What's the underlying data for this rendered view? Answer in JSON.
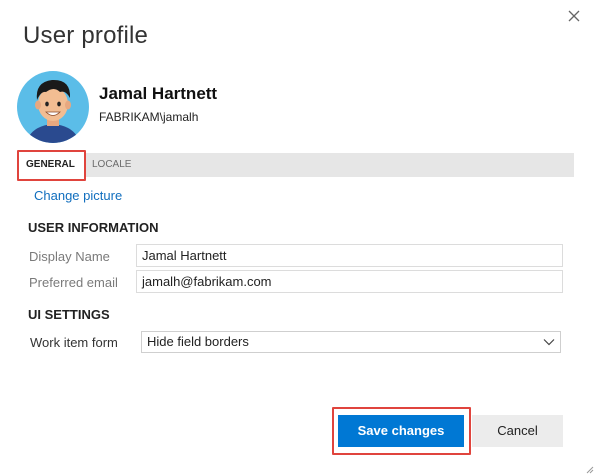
{
  "dialog": {
    "title": "User profile",
    "close_icon": "close-icon"
  },
  "user": {
    "name": "Jamal Hartnett",
    "account": "FABRIKAM\\jamalh",
    "avatar_icon": "avatar-cartoon",
    "avatar_bg": "#5bbde8"
  },
  "tabs": [
    {
      "label": "GENERAL",
      "selected": true
    },
    {
      "label": "LOCALE",
      "selected": false
    }
  ],
  "change_picture": "Change picture",
  "user_information": {
    "heading": "USER INFORMATION",
    "display_name_label": "Display Name",
    "display_name_value": "Jamal Hartnett",
    "preferred_email_label": "Preferred email",
    "preferred_email_value": "jamalh@fabrikam.com"
  },
  "ui_settings": {
    "heading": "UI SETTINGS",
    "work_item_form_label": "Work item form",
    "work_item_form_value": "Hide field borders"
  },
  "buttons": {
    "save": "Save changes",
    "cancel": "Cancel"
  },
  "colors": {
    "accent": "#0078d4",
    "highlight": "#e0443d",
    "link": "#106ebe"
  }
}
